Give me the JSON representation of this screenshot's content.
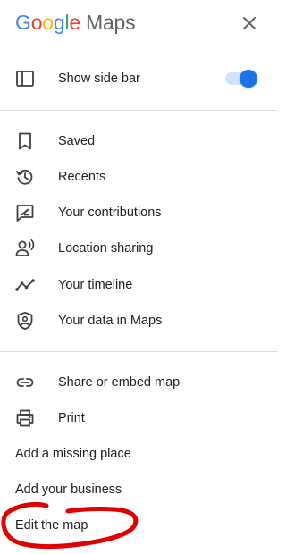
{
  "header": {
    "logo_letters": [
      {
        "char": "G",
        "color": "#4285F4"
      },
      {
        "char": "o",
        "color": "#EA4335"
      },
      {
        "char": "o",
        "color": "#FBBC05"
      },
      {
        "char": "g",
        "color": "#4285F4"
      },
      {
        "char": "l",
        "color": "#34A853"
      },
      {
        "char": "e",
        "color": "#EA4335"
      }
    ],
    "logo_suffix": "Maps",
    "close_icon": "close-icon"
  },
  "sidebar_toggle": {
    "label": "Show side bar",
    "icon": "side-panel-icon",
    "enabled": true,
    "accent_color": "#1A73E8"
  },
  "primary_items": [
    {
      "label": "Saved",
      "icon": "bookmark-icon"
    },
    {
      "label": "Recents",
      "icon": "history-icon"
    },
    {
      "label": "Your contributions",
      "icon": "contributions-icon"
    },
    {
      "label": "Location sharing",
      "icon": "location-sharing-icon"
    },
    {
      "label": "Your timeline",
      "icon": "timeline-icon"
    },
    {
      "label": "Your data in Maps",
      "icon": "shield-icon"
    }
  ],
  "secondary_items": [
    {
      "label": "Share or embed map",
      "icon": "link-icon"
    },
    {
      "label": "Print",
      "icon": "print-icon"
    }
  ],
  "text_items": [
    {
      "label": "Add a missing place"
    },
    {
      "label": "Add your business"
    },
    {
      "label": "Edit the map"
    }
  ],
  "annotation": {
    "color": "#E00000",
    "target": "Edit the map"
  }
}
